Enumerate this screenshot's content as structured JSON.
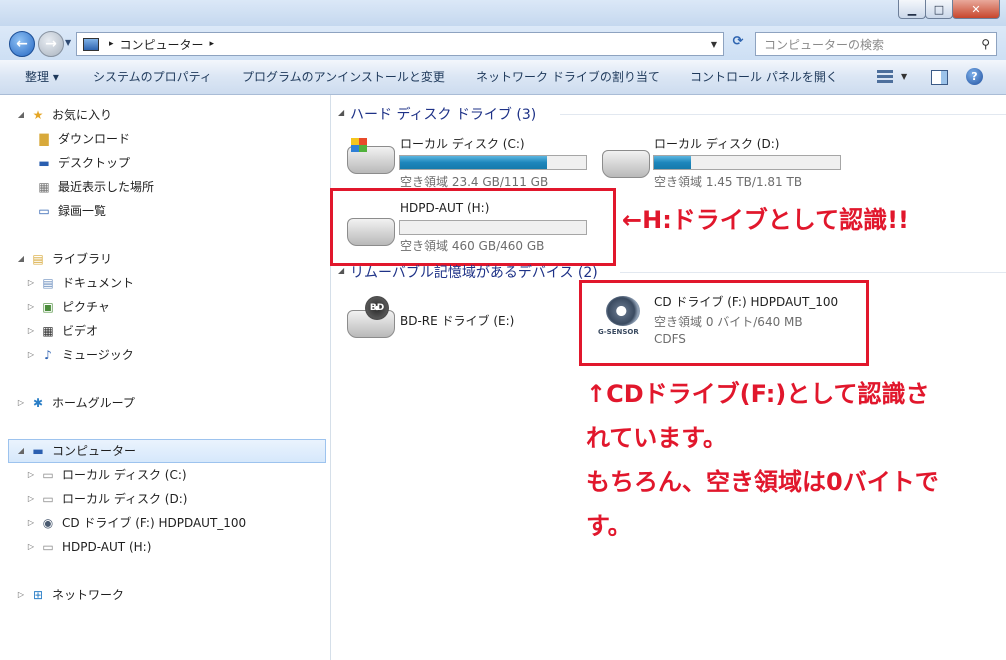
{
  "window": {
    "minimize": "▁",
    "maximize": "□",
    "close": "✕"
  },
  "address": {
    "root_icon": "computer-icon",
    "path": "コンピューター",
    "search_placeholder": "コンピューターの検索"
  },
  "toolbar": {
    "organize": "整理 ▾",
    "system_properties": "システムのプロパティ",
    "uninstall": "プログラムのアンインストールと変更",
    "map_drive": "ネットワーク ドライブの割り当て",
    "control_panel": "コントロール パネルを開く"
  },
  "nav": {
    "favorites": "お気に入り",
    "downloads": "ダウンロード",
    "desktop": "デスクトップ",
    "recent": "最近表示した場所",
    "recordings": "録画一覧",
    "libraries": "ライブラリ",
    "documents": "ドキュメント",
    "pictures": "ピクチャ",
    "videos": "ビデオ",
    "music": "ミュージック",
    "homegroup": "ホームグループ",
    "computer": "コンピューター",
    "local_c": "ローカル ディスク (C:)",
    "local_d": "ローカル ディスク (D:)",
    "cd_f": "CD ドライブ (F:) HDPDAUT_100",
    "hdpd_h": "HDPD-AUT (H:)",
    "network": "ネットワーク"
  },
  "groups": {
    "hdd": "ハード ディスク ドライブ (3)",
    "removable": "リムーバブル記憶域があるデバイス (2)"
  },
  "drives": {
    "c": {
      "label": "ローカル ディスク (C:)",
      "free": "空き領域 23.4 GB/111 GB",
      "used_fraction": 0.79
    },
    "d": {
      "label": "ローカル ディスク (D:)",
      "free": "空き領域 1.45 TB/1.81 TB",
      "used_fraction": 0.2
    },
    "h": {
      "label": "HDPD-AUT (H:)",
      "free": "空き領域 460 GB/460 GB",
      "used_fraction": 0.0
    },
    "e": {
      "label": "BD-RE ドライブ (E:)",
      "badge": "BD"
    },
    "f": {
      "label": "CD ドライブ (F:) HDPDAUT_100",
      "free": "空き領域 0 バイト/640 MB",
      "fs": "CDFS",
      "logo": "G-SENSOR"
    }
  },
  "annotations": {
    "h_note": "←H:ドライブとして認識!!",
    "f_note_1": "↑CDドライブ(F:)として認識さ",
    "f_note_2": "れています。",
    "f_note_3": "もちろん、空き領域は0バイトで",
    "f_note_4": "す。",
    "color": "#e1172c"
  }
}
